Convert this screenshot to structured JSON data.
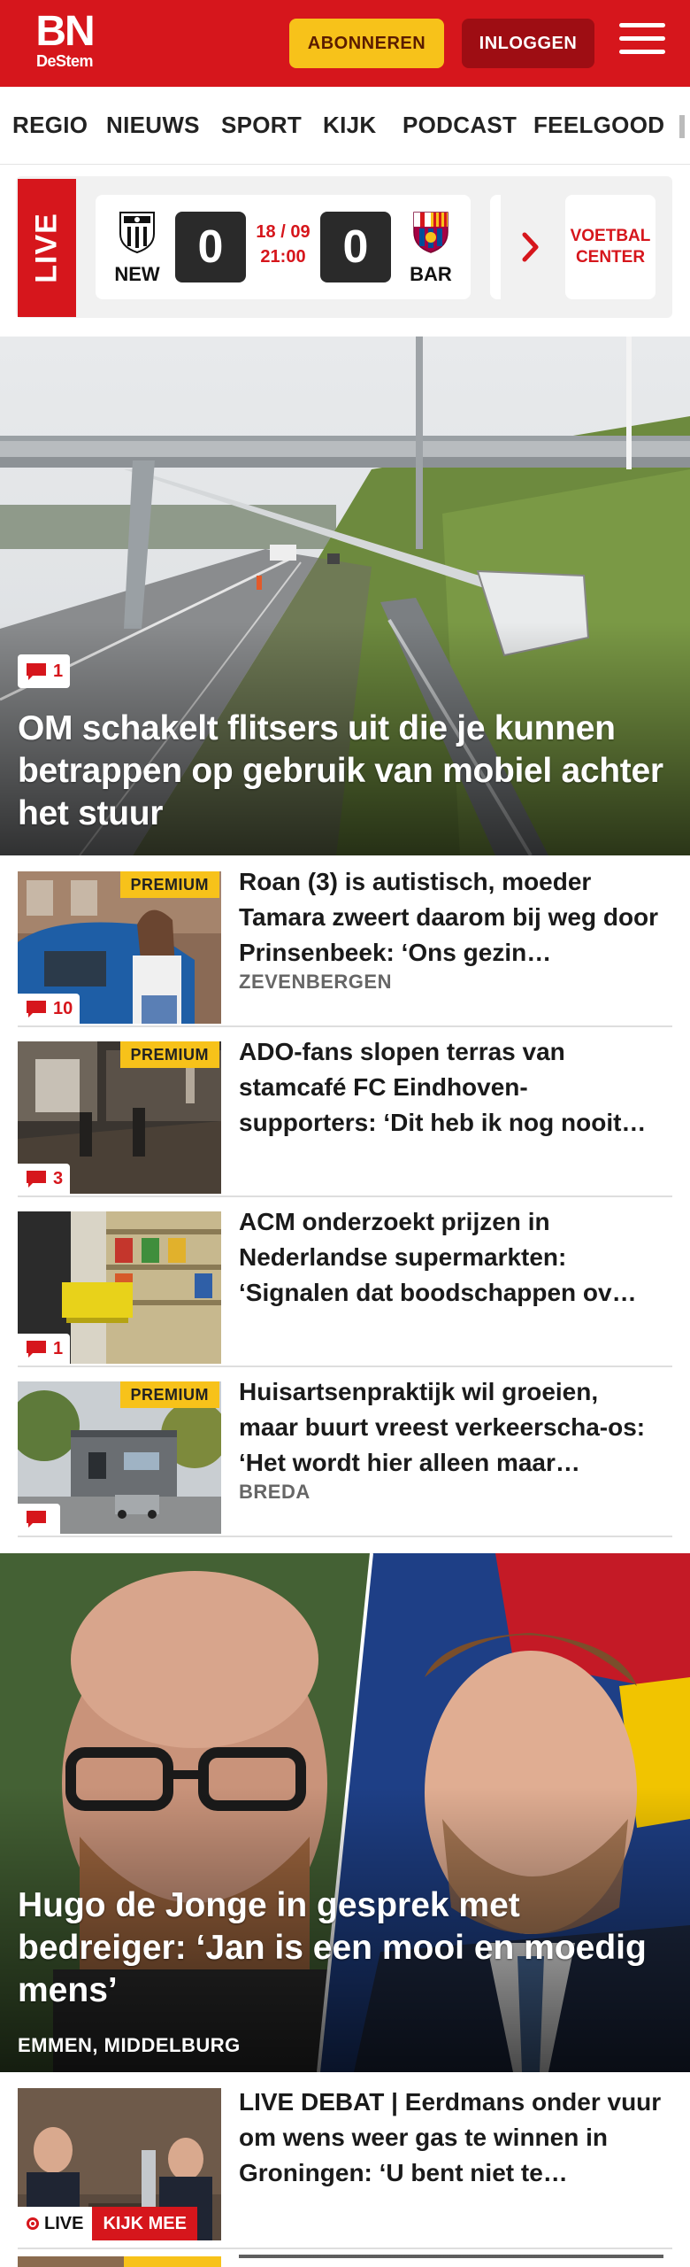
{
  "header": {
    "logo_main": "BN",
    "logo_sub": "DeStem",
    "subscribe_label": "ABONNEREN",
    "login_label": "INLOGGEN"
  },
  "nav": {
    "items": [
      "REGIO",
      "NIEUWS",
      "SPORT",
      "KIJK",
      "PODCAST",
      "FEELGOOD"
    ]
  },
  "live_scores": {
    "label": "LIVE",
    "match": {
      "home_code": "NEW",
      "home_score": "0",
      "date": "18 / 09",
      "time": "21:00",
      "away_score": "0",
      "away_code": "BAR"
    },
    "center_label_1": "VOETBAL",
    "center_label_2": "CENTER"
  },
  "hero": {
    "title": "OM schakelt flitsers uit die je kunnen betrappen op gebruik van mobiel achter het stuur",
    "comments": "1"
  },
  "articles": [
    {
      "title": "Roan (3) is autistisch, moeder Tamara zweert daarom bij weg door Prinsenbeek: ‘Ons gezin…",
      "location": "ZEVENBERGEN",
      "premium": "PREMIUM",
      "comments": "10"
    },
    {
      "title": "ADO-fans slopen terras van stamcafé FC Eindhoven-supporters: ‘Dit heb ik nog nooit…",
      "location": "",
      "premium": "PREMIUM",
      "comments": "3"
    },
    {
      "title": "ACM onderzoekt prijzen in Nederlandse supermarkten: ‘Signalen dat boodschappen ov…",
      "location": "",
      "premium": "",
      "comments": "1"
    },
    {
      "title": "Huisartsenpraktijk wil groeien, maar buurt vreest verkeerscha-os: ‘Het wordt hier alleen maar…",
      "location": "BREDA",
      "premium": "PREMIUM",
      "comments": ""
    }
  ],
  "feature": {
    "title": "Hugo de Jonge in gesprek met bedreiger: ‘Jan is een mooi en moedig mens’",
    "location": "EMMEN, MIDDELBURG"
  },
  "live_article": {
    "title": "LIVE DEBAT | Eerdmans onder vuur om wens weer gas te winnen in Groningen: ‘U bent niet te…",
    "live_label": "LIVE",
    "watch_label": "KIJK MEE"
  },
  "colors": {
    "brand_red": "#d6161c",
    "subscribe_yellow": "#f7c21a",
    "login_dark_red": "#9e0d13"
  }
}
